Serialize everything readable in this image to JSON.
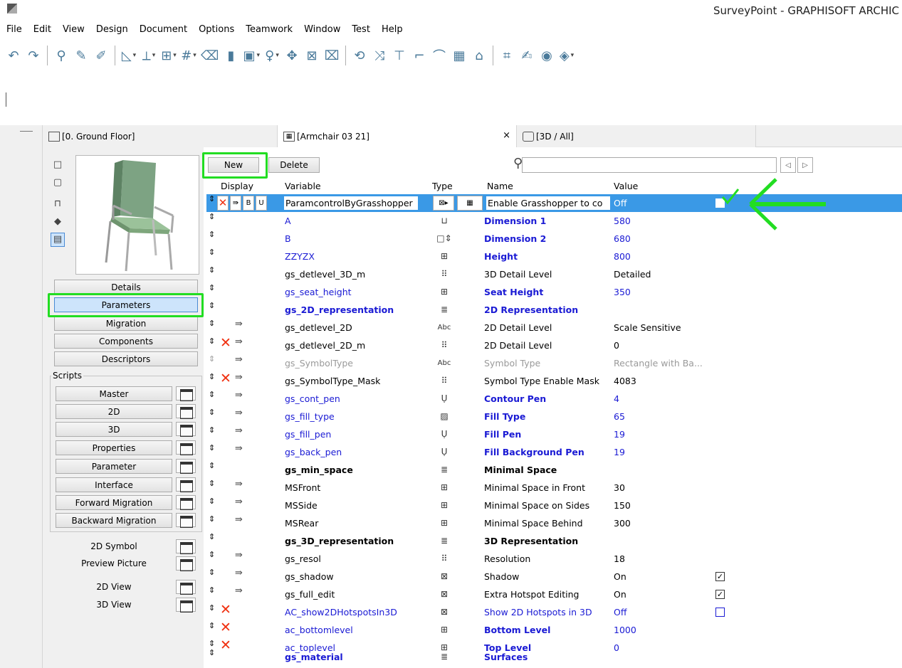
{
  "window": {
    "title": "SurveyPoint - GRAPHISOFT ARCHIC"
  },
  "menu": [
    "File",
    "Edit",
    "View",
    "Design",
    "Document",
    "Options",
    "Teamwork",
    "Window",
    "Test",
    "Help"
  ],
  "tabs": [
    {
      "label": "[0. Ground Floor]"
    },
    {
      "label": "[Armchair 03 21]",
      "close": "×"
    },
    {
      "label": "[3D / All]"
    }
  ],
  "side_nav": [
    "Details",
    "Parameters",
    "Migration",
    "Components",
    "Descriptors"
  ],
  "scripts": {
    "label": "Scripts",
    "buttons": [
      "Master",
      "2D",
      "3D",
      "Properties",
      "Parameter",
      "Interface",
      "Forward Migration",
      "Backward Migration"
    ]
  },
  "views": [
    "2D Symbol",
    "Preview Picture",
    "2D View",
    "3D View"
  ],
  "toolbar_params": {
    "new_label": "New",
    "delete_label": "Delete",
    "search_value": ""
  },
  "columns": {
    "display": "Display",
    "variable": "Variable",
    "type": "Type",
    "name": "Name",
    "value": "Value"
  },
  "selected_row_flags": [
    "B",
    "U"
  ],
  "rows": [
    {
      "variable": "ParamcontrolByGrasshopper",
      "name": "Enable Grasshopper to co",
      "value": "Off"
    },
    {
      "variable": "A",
      "name": "Dimension 1",
      "value": "580"
    },
    {
      "variable": "B",
      "name": "Dimension 2",
      "value": "680"
    },
    {
      "variable": "ZZYZX",
      "name": "Height",
      "value": "800"
    },
    {
      "variable": "gs_detlevel_3D_m",
      "name": "3D Detail Level",
      "value": "Detailed"
    },
    {
      "variable": "gs_seat_height",
      "name": "Seat Height",
      "value": "350"
    },
    {
      "variable": "gs_2D_representation",
      "name": "2D Representation",
      "value": ""
    },
    {
      "variable": "gs_detlevel_2D",
      "type": "Abc",
      "name": "2D Detail Level",
      "value": "Scale Sensitive"
    },
    {
      "variable": "gs_detlevel_2D_m",
      "name": "2D Detail Level",
      "value": "0"
    },
    {
      "variable": "gs_SymbolType",
      "type": "Abc",
      "name": "Symbol Type",
      "value": "Rectangle with Ba..."
    },
    {
      "variable": "gs_SymbolType_Mask",
      "name": "Symbol Type Enable Mask",
      "value": "4083"
    },
    {
      "variable": "gs_cont_pen",
      "name": "Contour Pen",
      "value": "4"
    },
    {
      "variable": "gs_fill_type",
      "name": "Fill Type",
      "value": "65"
    },
    {
      "variable": "gs_fill_pen",
      "name": "Fill Pen",
      "value": "19"
    },
    {
      "variable": "gs_back_pen",
      "name": "Fill Background Pen",
      "value": "19"
    },
    {
      "variable": "gs_min_space",
      "name": "Minimal Space",
      "value": ""
    },
    {
      "variable": "MSFront",
      "name": "Minimal Space in Front",
      "value": "30"
    },
    {
      "variable": "MSSide",
      "name": "Minimal Space on Sides",
      "value": "150"
    },
    {
      "variable": "MSRear",
      "name": "Minimal Space Behind",
      "value": "300"
    },
    {
      "variable": "gs_3D_representation",
      "name": "3D Representation",
      "value": ""
    },
    {
      "variable": "gs_resol",
      "name": "Resolution",
      "value": "18"
    },
    {
      "variable": "gs_shadow",
      "name": "Shadow",
      "value": "On"
    },
    {
      "variable": "gs_full_edit",
      "name": "Extra Hotspot Editing",
      "value": "On"
    },
    {
      "variable": "AC_show2DHotspotsIn3D",
      "name": "Show 2D Hotspots in 3D",
      "value": "Off"
    },
    {
      "variable": "ac_bottomlevel",
      "name": "Bottom Level",
      "value": "1000"
    },
    {
      "variable": "ac_toplevel",
      "name": "Top Level",
      "value": "0"
    },
    {
      "variable": "gs_material",
      "name": "Surfaces",
      "value": ""
    }
  ],
  "colors": {
    "selection": "#3a99e6",
    "highlight": "#22dd22",
    "link_blue": "#1a1ad4",
    "delete_red": "#f03010"
  }
}
